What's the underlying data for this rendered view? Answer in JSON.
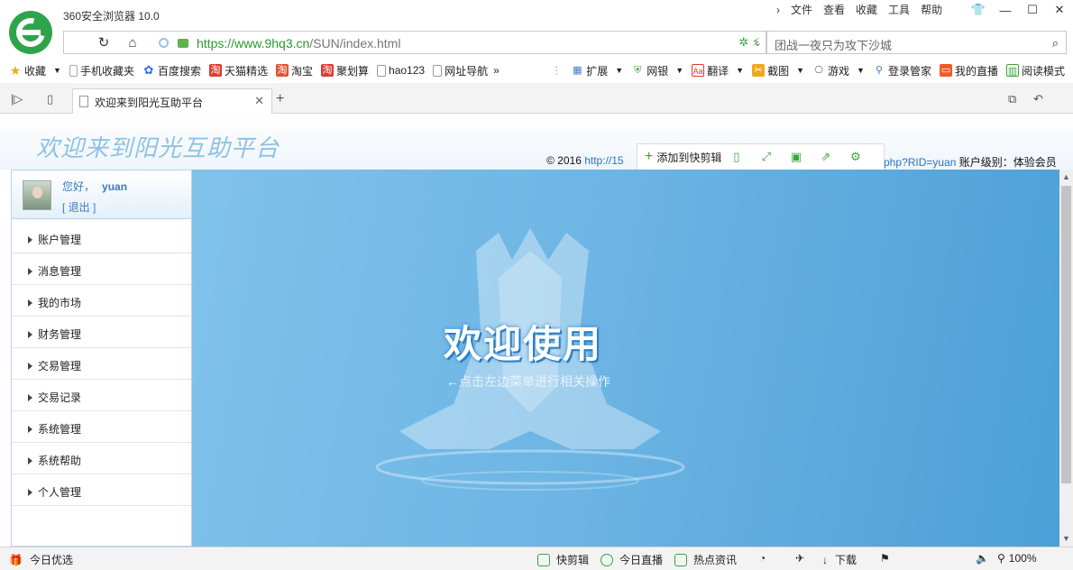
{
  "window": {
    "title": "360安全浏览器 10.0",
    "menus": [
      "文件",
      "查看",
      "收藏",
      "工具",
      "帮助"
    ]
  },
  "address": {
    "url_host": "https://www.9hq3.cn",
    "url_path": "/SUN/index.html",
    "search_placeholder": "团战一夜只为攻下沙城"
  },
  "bookmarks": [
    {
      "label": "收藏",
      "color": "#f2a71c",
      "glyph": "★"
    },
    {
      "label": "手机收藏夹",
      "color": "#5aa0e0",
      "glyph": "▯"
    },
    {
      "label": "百度搜索",
      "color": "#2f6be0",
      "glyph": "✿"
    },
    {
      "label": "天猫精选",
      "color": "#e03a2f",
      "glyph": "淘"
    },
    {
      "label": "淘宝",
      "color": "#e0532f",
      "glyph": "淘"
    },
    {
      "label": "聚划算",
      "color": "#e03a2f",
      "glyph": "淘"
    },
    {
      "label": "hao123",
      "color": "#ffffff",
      "glyph": "▫"
    },
    {
      "label": "网址导航",
      "color": "#ffffff",
      "glyph": "▫"
    }
  ],
  "tools": [
    "扩展",
    "网银",
    "翻译",
    "截图",
    "游戏",
    "登录管家",
    "我的直播",
    "阅读模式"
  ],
  "tab": {
    "title": "欢迎来到阳光互助平台"
  },
  "page": {
    "site_title": "欢迎来到阳光互助平台",
    "copyright": "© 2016",
    "link_start": "http://15",
    "link_end": "php?RID=yuan",
    "account_level": "账户级别：体验会员",
    "snip_add": "添加到快剪辑"
  },
  "user": {
    "greeting": "您好，",
    "name": "yuan",
    "logout": "[ 退出 ]"
  },
  "sidebar_menu": [
    "账户管理",
    "消息管理",
    "我的市场",
    "财务管理",
    "交易管理",
    "交易记录",
    "系统管理",
    "系统帮助",
    "个人管理"
  ],
  "main": {
    "welcome": "欢迎使用",
    "hint": "←点击左边菜单进行相关操作"
  },
  "status": {
    "left": "今日优选",
    "kuaijianji": "快剪辑",
    "live": "今日直播",
    "news": "热点资讯",
    "download": "下载",
    "zoom": "100%"
  },
  "colors": {
    "accent_green": "#3aa53a",
    "main_blue": "#6db5e4",
    "link_blue": "#2a74c4"
  }
}
